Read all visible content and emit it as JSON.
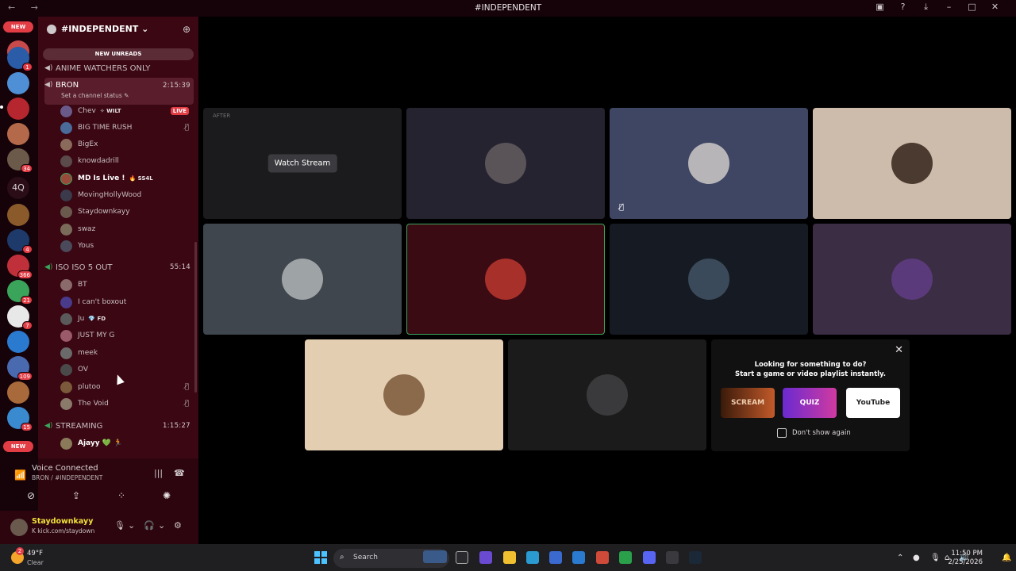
{
  "window": {
    "title": "#INDEPENDENT",
    "nav": "←  →"
  },
  "servers": {
    "top_pill": "NEW",
    "bottom_pill": "NEW",
    "text_icon": "4Q",
    "badges": [
      "1",
      "34",
      "4",
      "366",
      "21",
      "7",
      "109",
      "15"
    ]
  },
  "guild": {
    "name": "#INDEPENDENT ⌄",
    "new_unreads": "NEW UNREADS"
  },
  "channels": {
    "anime": "ANIME WATCHERS ONLY",
    "bron": {
      "name": "BRON",
      "time": "2:15:39",
      "status": "Set a channel status ✎"
    },
    "iso": {
      "name": "ISO ISO 5 OUT",
      "time": "55:14"
    },
    "streaming": {
      "name": "STREAMING",
      "time": "1:15:27"
    }
  },
  "bron_users": [
    {
      "name": "Chev",
      "tag": "✧ WILT",
      "live": "LIVE"
    },
    {
      "name": "BIG TIME RUSH"
    },
    {
      "name": "BigEx"
    },
    {
      "name": "knowdadrill"
    },
    {
      "name": "MD Is Live !",
      "tag": "🔥 SS4L"
    },
    {
      "name": "MovingHollyWood"
    },
    {
      "name": "Staydownkayy"
    },
    {
      "name": "swaz"
    },
    {
      "name": "Yous"
    }
  ],
  "iso_users": [
    {
      "name": "BT"
    },
    {
      "name": "I can't boxout"
    },
    {
      "name": "Ju",
      "tag": "💎 FD"
    },
    {
      "name": "JUST MY G"
    },
    {
      "name": "meek"
    },
    {
      "name": "OV"
    },
    {
      "name": "plutoo"
    },
    {
      "name": "The Void"
    }
  ],
  "streaming_users": [
    {
      "name": "Ajayy 💚 🏃"
    }
  ],
  "voice": {
    "title": "Voice Connected",
    "subtitle": "BRON / #INDEPENDENT"
  },
  "me": {
    "name": "Staydownkayy",
    "sub": "K kick.com/staydown"
  },
  "stage": {
    "watch_stream": "Watch Stream",
    "after_label": "AFTER"
  },
  "promo": {
    "line1": "Looking for something to do?",
    "line2": "Start a game or video playlist instantly.",
    "cards": [
      "SCREAM",
      "QUIZ",
      "YouTube"
    ],
    "dont_show": "Don't show again"
  },
  "taskbar": {
    "temp": "49°F",
    "condition": "Clear",
    "weather_badge": "2",
    "search": "Search",
    "time": "11:50 PM",
    "date": "2/25/2026"
  },
  "colors": {
    "sidebar": "#3a0713",
    "server_rail": "#16030a",
    "accent_red": "#e23c45",
    "speaking_green": "#3ba55c"
  }
}
